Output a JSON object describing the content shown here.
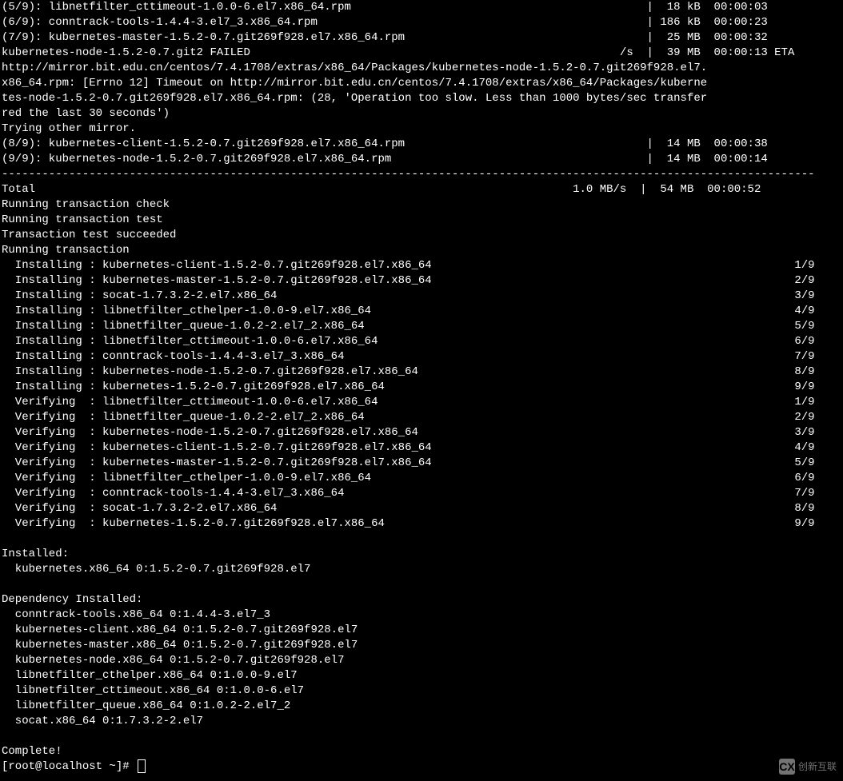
{
  "downloads": [
    {
      "prefix": "(5/9): ",
      "name": "libnetfilter_cttimeout-1.0.0-6.el7.x86_64.rpm",
      "sep": "|",
      "size": " 18 kB",
      "time": "  00:00:03"
    },
    {
      "prefix": "(6/9): ",
      "name": "conntrack-tools-1.4.4-3.el7_3.x86_64.rpm",
      "sep": "|",
      "size": "186 kB",
      "time": "  00:00:23"
    },
    {
      "prefix": "(7/9): ",
      "name": "kubernetes-master-1.5.2-0.7.git269f928.el7.x86_64.rpm",
      "sep": "|",
      "size": " 25 MB",
      "time": "  00:00:32"
    },
    {
      "prefix": "",
      "name": "kubernetes-node-1.5.2-0.7.git2 FAILED",
      "sep": "/s  |",
      "size": " 39 MB",
      "time": "  00:00:13 ETA"
    }
  ],
  "error_lines": [
    "http://mirror.bit.edu.cn/centos/7.4.1708/extras/x86_64/Packages/kubernetes-node-1.5.2-0.7.git269f928.el7.",
    "x86_64.rpm: [Errno 12] Timeout on http://mirror.bit.edu.cn/centos/7.4.1708/extras/x86_64/Packages/kuberne",
    "tes-node-1.5.2-0.7.git269f928.el7.x86_64.rpm: (28, 'Operation too slow. Less than 1000 bytes/sec transfer",
    "red the last 30 seconds')",
    "Trying other mirror."
  ],
  "downloads2": [
    {
      "prefix": "(8/9): ",
      "name": "kubernetes-client-1.5.2-0.7.git269f928.el7.x86_64.rpm",
      "sep": "|",
      "size": " 14 MB",
      "time": "  00:00:38"
    },
    {
      "prefix": "(9/9): ",
      "name": "kubernetes-node-1.5.2-0.7.git269f928.el7.x86_64.rpm",
      "sep": "|",
      "size": " 14 MB",
      "time": "  00:00:14"
    }
  ],
  "separator": "-------------------------------------------------------------------------------------------------------------------------",
  "total_line": {
    "label": "Total",
    "rate": "1.0 MB/s",
    "sep": "|",
    "size": " 54 MB",
    "time": "  00:00:52"
  },
  "trans_msgs": [
    "Running transaction check",
    "Running transaction test",
    "Transaction test succeeded",
    "Running transaction"
  ],
  "install_steps": [
    {
      "action": "Installing",
      "pkg": "kubernetes-client-1.5.2-0.7.git269f928.el7.x86_64",
      "count": "1/9"
    },
    {
      "action": "Installing",
      "pkg": "kubernetes-master-1.5.2-0.7.git269f928.el7.x86_64",
      "count": "2/9"
    },
    {
      "action": "Installing",
      "pkg": "socat-1.7.3.2-2.el7.x86_64",
      "count": "3/9"
    },
    {
      "action": "Installing",
      "pkg": "libnetfilter_cthelper-1.0.0-9.el7.x86_64",
      "count": "4/9"
    },
    {
      "action": "Installing",
      "pkg": "libnetfilter_queue-1.0.2-2.el7_2.x86_64",
      "count": "5/9"
    },
    {
      "action": "Installing",
      "pkg": "libnetfilter_cttimeout-1.0.0-6.el7.x86_64",
      "count": "6/9"
    },
    {
      "action": "Installing",
      "pkg": "conntrack-tools-1.4.4-3.el7_3.x86_64",
      "count": "7/9"
    },
    {
      "action": "Installing",
      "pkg": "kubernetes-node-1.5.2-0.7.git269f928.el7.x86_64",
      "count": "8/9"
    },
    {
      "action": "Installing",
      "pkg": "kubernetes-1.5.2-0.7.git269f928.el7.x86_64",
      "count": "9/9"
    },
    {
      "action": "Verifying ",
      "pkg": "libnetfilter_cttimeout-1.0.0-6.el7.x86_64",
      "count": "1/9"
    },
    {
      "action": "Verifying ",
      "pkg": "libnetfilter_queue-1.0.2-2.el7_2.x86_64",
      "count": "2/9"
    },
    {
      "action": "Verifying ",
      "pkg": "kubernetes-node-1.5.2-0.7.git269f928.el7.x86_64",
      "count": "3/9"
    },
    {
      "action": "Verifying ",
      "pkg": "kubernetes-client-1.5.2-0.7.git269f928.el7.x86_64",
      "count": "4/9"
    },
    {
      "action": "Verifying ",
      "pkg": "kubernetes-master-1.5.2-0.7.git269f928.el7.x86_64",
      "count": "5/9"
    },
    {
      "action": "Verifying ",
      "pkg": "libnetfilter_cthelper-1.0.0-9.el7.x86_64",
      "count": "6/9"
    },
    {
      "action": "Verifying ",
      "pkg": "conntrack-tools-1.4.4-3.el7_3.x86_64",
      "count": "7/9"
    },
    {
      "action": "Verifying ",
      "pkg": "socat-1.7.3.2-2.el7.x86_64",
      "count": "8/9"
    },
    {
      "action": "Verifying ",
      "pkg": "kubernetes-1.5.2-0.7.git269f928.el7.x86_64",
      "count": "9/9"
    }
  ],
  "installed_header": "Installed:",
  "installed_pkg": "  kubernetes.x86_64 0:1.5.2-0.7.git269f928.el7",
  "dep_header": "Dependency Installed:",
  "dep_pkgs": [
    "  conntrack-tools.x86_64 0:1.4.4-3.el7_3",
    "  kubernetes-client.x86_64 0:1.5.2-0.7.git269f928.el7",
    "  kubernetes-master.x86_64 0:1.5.2-0.7.git269f928.el7",
    "  kubernetes-node.x86_64 0:1.5.2-0.7.git269f928.el7",
    "  libnetfilter_cthelper.x86_64 0:1.0.0-9.el7",
    "  libnetfilter_cttimeout.x86_64 0:1.0.0-6.el7",
    "  libnetfilter_queue.x86_64 0:1.0.2-2.el7_2",
    "  socat.x86_64 0:1.7.3.2-2.el7"
  ],
  "complete": "Complete!",
  "prompt": "[root@localhost ~]# ",
  "watermark": {
    "icon": "CX",
    "text": "创新互联"
  }
}
